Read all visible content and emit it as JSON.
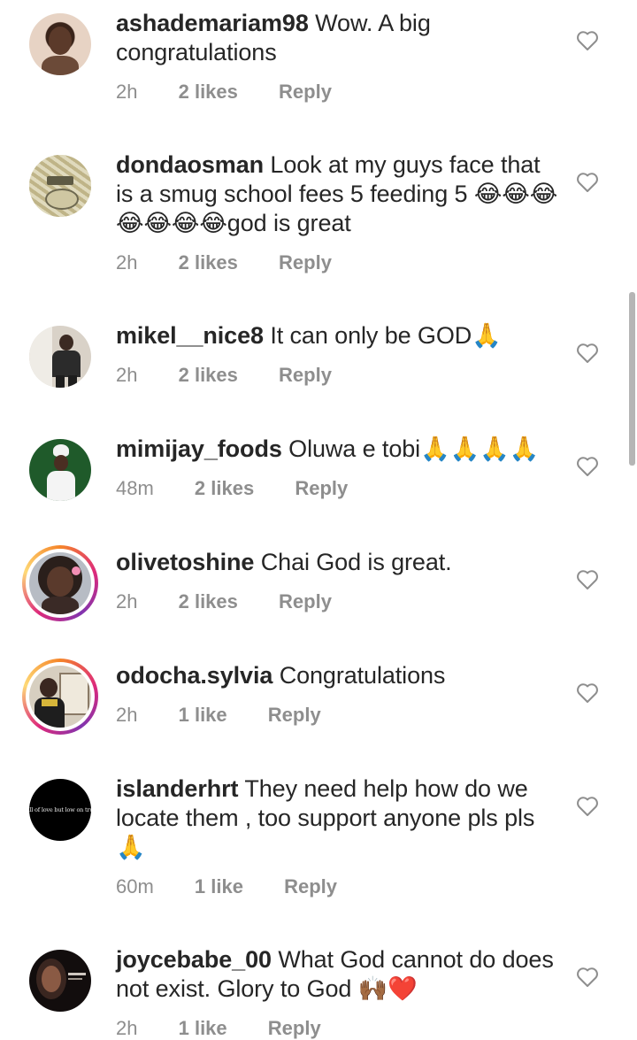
{
  "comments": [
    {
      "user": "ashademariam98",
      "text": "Wow. A big congratulations",
      "time": "2h",
      "likes": "2 likes",
      "reply": "Reply"
    },
    {
      "user": "dondaosman",
      "text": "Look at my guys face that is a smug school fees 5 feeding 5 😂😂😂😂😂😂😂god is great",
      "time": "2h",
      "likes": "2 likes",
      "reply": "Reply"
    },
    {
      "user": "mikel__nice8",
      "text": "It can only be GOD🙏",
      "time": "2h",
      "likes": "2 likes",
      "reply": "Reply"
    },
    {
      "user": "mimijay_foods",
      "text": "Oluwa e tobi🙏🙏🙏🙏",
      "time": "48m",
      "likes": "2 likes",
      "reply": "Reply"
    },
    {
      "user": "olivetoshine",
      "text": "Chai God is great.",
      "time": "2h",
      "likes": "2 likes",
      "reply": "Reply"
    },
    {
      "user": "odocha.sylvia",
      "text": "Congratulations",
      "time": "2h",
      "likes": "1 like",
      "reply": "Reply"
    },
    {
      "user": "islanderhrt",
      "text": "They need help how do we locate them , too support anyone pls pls 🙏",
      "time": "60m",
      "likes": "1 like",
      "reply": "Reply",
      "avatar_text": "Full of love but low on trust"
    },
    {
      "user": "joycebabe_00",
      "text": "What God cannot do does not exist. Glory to God 🙌🏾❤️",
      "time": "2h",
      "likes": "1 like",
      "reply": "Reply"
    }
  ],
  "icons": {
    "like": "heart-outline-icon"
  },
  "colors": {
    "text": "#262626",
    "meta": "#8e8e8e",
    "heart_stroke": "#8e8e8e"
  }
}
